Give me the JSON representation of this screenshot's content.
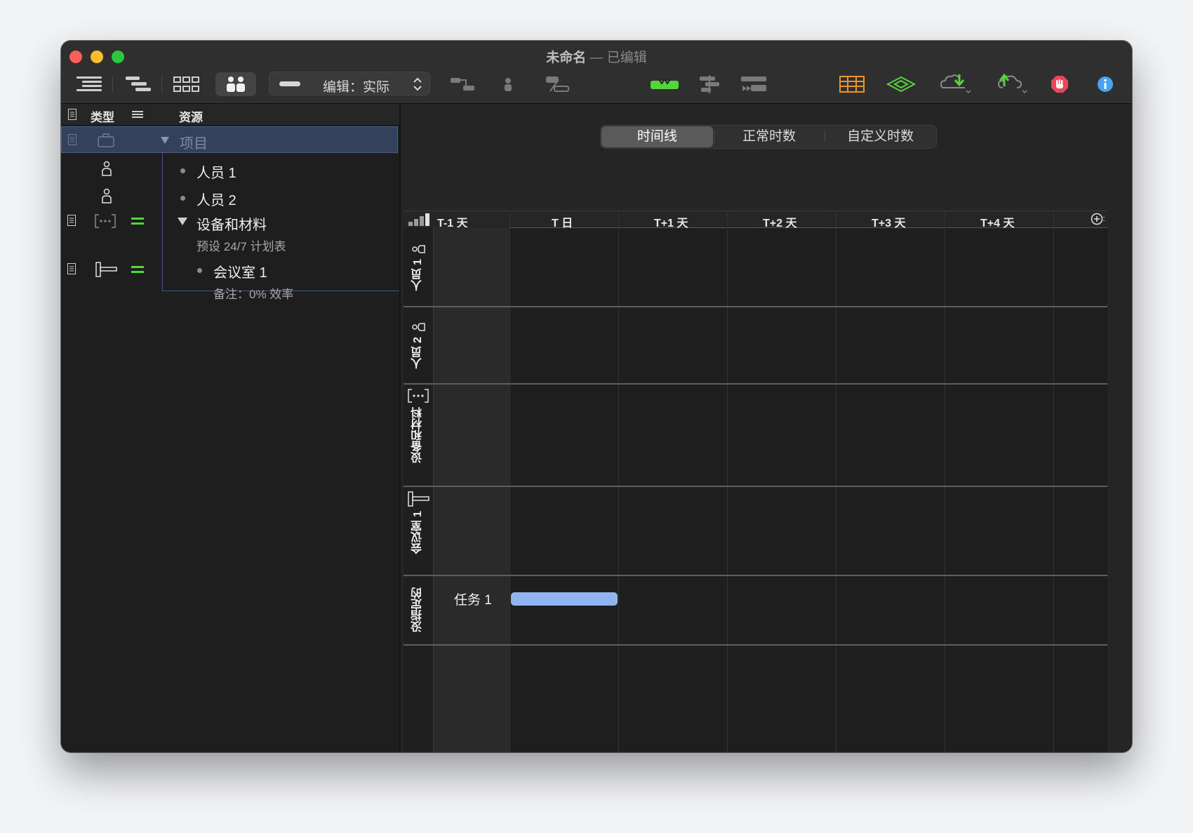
{
  "window": {
    "title": "未命名",
    "separator": "—",
    "subtitle": "已编辑"
  },
  "toolbar": {
    "mode_label": "编辑：实际",
    "icons": [
      "outline-icon",
      "gantt-icon",
      "network-icon",
      "resources-icon",
      "connect-icon",
      "assign-resource-icon",
      "split-task-icon",
      "level-icon",
      "align-icon",
      "group-icon",
      "table-icon",
      "baseline-icon",
      "cloud-download-icon",
      "cloud-upload-icon",
      "stop-icon",
      "info-icon"
    ],
    "accent_green": "#55d43b",
    "table_orange": "#e8932b",
    "stop_red": "#e8475a",
    "info_blue": "#4aa3f0"
  },
  "outline": {
    "col_type": "类型",
    "col_resource": "资源",
    "rows": [
      {
        "label": "项目",
        "kind": "project"
      },
      {
        "label": "人员 1",
        "kind": "person"
      },
      {
        "label": "人员 2",
        "kind": "person"
      },
      {
        "label": "设备和材料",
        "kind": "equipment",
        "note": "预设 24/7 计划表"
      },
      {
        "label": "会议室 1",
        "kind": "room",
        "note": "备注：0% 效率"
      }
    ]
  },
  "view_tabs": [
    "时间线",
    "正常时数",
    "自定义时数"
  ],
  "active_tab": 0,
  "timeline": {
    "days": [
      "T-1 天",
      "T 日",
      "T+1 天",
      "T+2 天",
      "T+3 天",
      "T+4 天"
    ],
    "rows": [
      "人员 1",
      "人员 2",
      "设备和材料",
      "会议室 1",
      "没指定的"
    ],
    "tasks": [
      {
        "name": "任务 1",
        "row": 4,
        "start_day": 1,
        "duration_days": 1
      }
    ],
    "bar_color": "#8fb4f0"
  }
}
